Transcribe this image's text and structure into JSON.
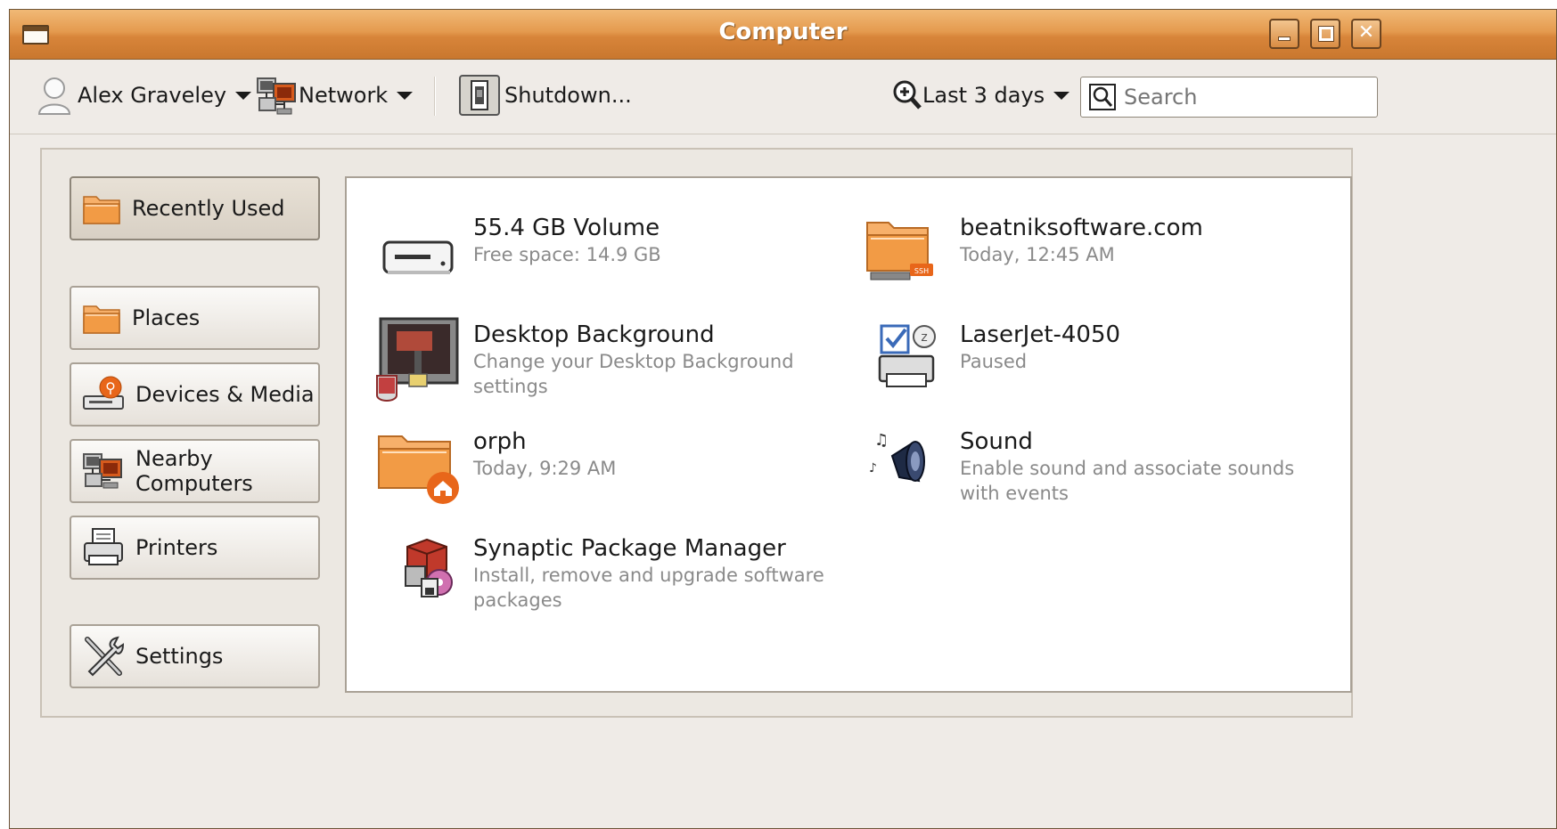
{
  "window": {
    "title": "Computer"
  },
  "toolbar": {
    "user_label": "Alex Graveley",
    "network_label": "Network",
    "shutdown_label": "Shutdown...",
    "date_filter_label": "Last 3 days",
    "search_placeholder": "Search"
  },
  "sidebar": {
    "items": [
      {
        "label": "Recently Used",
        "icon": "folder-icon",
        "active": true
      },
      {
        "label": "Places",
        "icon": "folder-icon"
      },
      {
        "label": "Devices & Media",
        "icon": "usb-drive-icon"
      },
      {
        "label": "Nearby Computers",
        "icon": "network-computers-icon"
      },
      {
        "label": "Printers",
        "icon": "printer-icon"
      },
      {
        "label": "Settings",
        "icon": "tools-icon"
      }
    ]
  },
  "content": {
    "items": [
      {
        "title": "55.4 GB Volume",
        "subtitle": "Free space: 14.9 GB",
        "icon": "hard-drive-icon"
      },
      {
        "title": "beatniksoftware.com",
        "subtitle": "Today, 12:45 AM",
        "icon": "ssh-folder-icon"
      },
      {
        "title": "Desktop Background",
        "subtitle": "Change your Desktop Background settings",
        "icon": "desktop-background-icon"
      },
      {
        "title": "LaserJet-4050",
        "subtitle": "Paused",
        "icon": "printer-icon"
      },
      {
        "title": "orph",
        "subtitle": "Today,  9:29 AM",
        "icon": "home-folder-icon"
      },
      {
        "title": "Sound",
        "subtitle": "Enable sound and associate sounds with events",
        "icon": "speaker-icon"
      },
      {
        "title": "Synaptic Package Manager",
        "subtitle": "Install, remove and upgrade software packages",
        "icon": "package-icon"
      }
    ]
  },
  "colors": {
    "titlebar": "#e49a4e",
    "window_bg": "#efebe7",
    "folder_orange": "#f0a050",
    "subtitle_gray": "#8a8a8a"
  }
}
